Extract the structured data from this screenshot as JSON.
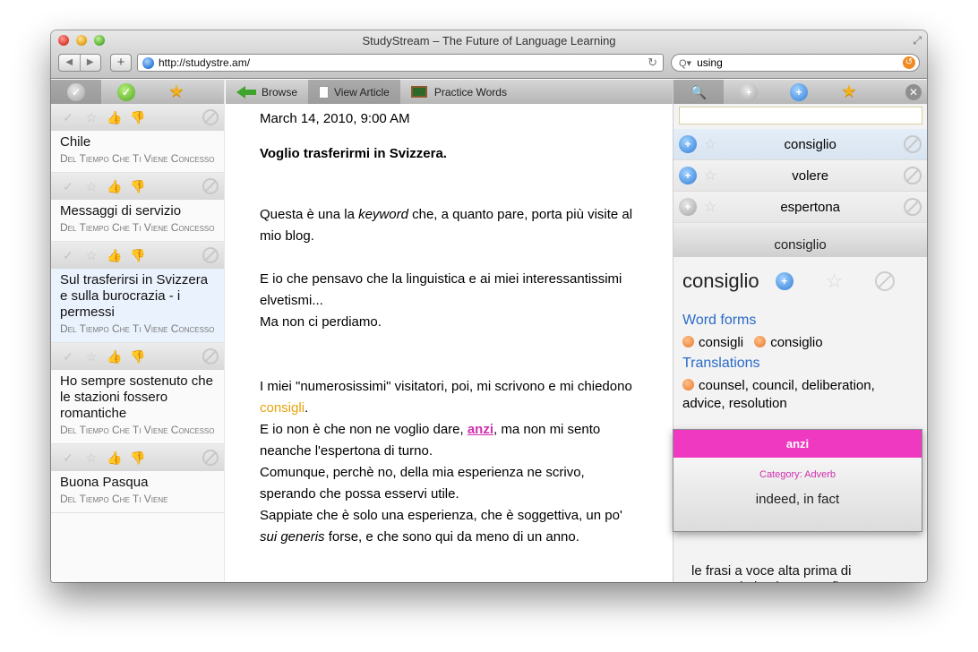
{
  "window": {
    "title": "StudyStream – The Future of Language Learning"
  },
  "toolbar": {
    "back_icon": "◀",
    "forward_icon": "▶",
    "add_icon": "+",
    "url": "http://studystre.am/",
    "reload_icon": "↻",
    "search_value": "using",
    "search_icon": "Q▾",
    "snapback_icon": "↺"
  },
  "left_panel": {
    "tabs": [
      {
        "icon": "grey-check-icon",
        "glyph": "✓"
      },
      {
        "icon": "green-check-icon",
        "glyph": "✓"
      },
      {
        "icon": "star-icon",
        "glyph": "★"
      }
    ],
    "action_glyphs": {
      "check": "✓",
      "star": "☆",
      "thumbs_up": "👍",
      "thumbs_down": "👎"
    },
    "articles": [
      {
        "title": "Chile",
        "source": "Del Tiempo Che Ti Viene Concesso"
      },
      {
        "title": "Messaggi di servizio",
        "source": "Del Tiempo Che Ti Viene Concesso"
      },
      {
        "title": "Sul trasferirsi in Svizzera e sulla burocrazia - i permessi",
        "source": "Del Tiempo Che Ti Viene Concesso"
      },
      {
        "title": "Ho sempre sostenuto che le stazioni fossero romantiche",
        "source": "Del Tiempo Che Ti Viene Concesso"
      },
      {
        "title": "Buona Pasqua",
        "source": "Del Tiempo Che Ti Viene"
      }
    ]
  },
  "middle_panel": {
    "tabs": {
      "browse": "Browse",
      "view_article": "View Article",
      "practice_words": "Practice Words"
    },
    "article": {
      "date": "March 14, 2010, 9:00 AM",
      "headline": "Voglio trasferirmi in Svizzera.",
      "p1_a": "Questa è una la ",
      "p1_em": "keyword",
      "p1_b": " che, a quanto pare, porta più visite al mio blog.",
      "p2": "E io che pensavo che la linguistica e ai miei interessantissimi elvetismi...",
      "p3": "Ma non ci perdiamo.",
      "p4_a": "I miei \"numerosissimi\" visitatori, poi, mi scrivono e mi chiedono ",
      "p4_word": "consigli",
      "p4_b": ".",
      "p5_a": "E io non è che non ne voglio dare, ",
      "p5_word": "anzi",
      "p5_b": ", ma non mi sento neanche l'espertona di turno.",
      "p6": "Comunque, perchè no, della mia esperienza ne scrivo, sperando che possa esservi utile.",
      "p7_a": "Sappiate che è solo una esperienza, che è soggettiva, un po' ",
      "p7_em": "sui generis",
      "p7_b": " forse, e che sono qui da meno di un anno."
    }
  },
  "right_panel": {
    "tabs": [
      {
        "icon": "magnifier-icon",
        "glyph": "🔍"
      },
      {
        "icon": "grey-plus-icon",
        "glyph": "+"
      },
      {
        "icon": "blue-plus-icon",
        "glyph": "+"
      },
      {
        "icon": "star-icon",
        "glyph": "★"
      }
    ],
    "close_glyph": "✕",
    "vocab": [
      {
        "word": "consiglio",
        "plus": "+",
        "star": "☆"
      },
      {
        "word": "volere",
        "plus": "+",
        "star": "☆"
      },
      {
        "word": "espertona",
        "plus": "+",
        "star": "☆"
      }
    ],
    "detail": {
      "header": "consiglio",
      "word": "consiglio",
      "plus_glyph": "+",
      "star_glyph": "☆",
      "word_forms_label": "Word forms",
      "word_forms": [
        "consigli",
        "consiglio"
      ],
      "translations_label": "Translations",
      "translations": "counsel, council, deliberation, advice, resolution"
    },
    "snippet": "le frasi a voce alta prima di stamparle in gigantografie a colori. [Continua il movimento:",
    "scroll_up_glyph": "︿"
  },
  "popup": {
    "word": "anzi",
    "category": "Category: Adverb",
    "meaning": "indeed, in fact"
  },
  "colors": {
    "accent_pink": "#ef39c0",
    "link_blue": "#2a6bc7",
    "highlight_orange": "#e8a20c"
  }
}
